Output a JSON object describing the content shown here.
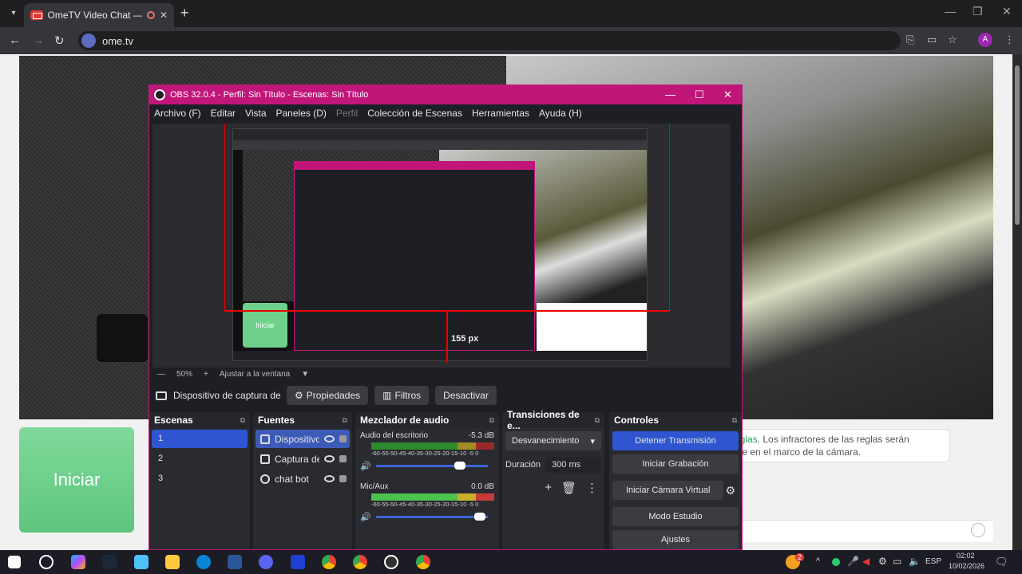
{
  "browser": {
    "tab_title": "OmeTV Video Chat — Ome",
    "url": "ome.tv",
    "profile_initial": "A"
  },
  "page": {
    "start_label": "Iniciar",
    "rules_link": "eglas",
    "rules_text_1": ". Los infractores de las reglas serán",
    "rules_text_2": "ple en el marco de la cámara."
  },
  "obs": {
    "title": "OBS 32.0.4 - Perfil: Sin Título - Escenas: Sin Título",
    "menu": [
      "Archivo (F)",
      "Editar",
      "Vista",
      "Paneles (D)",
      "Perfil",
      "Colección de Escenas",
      "Herramientas",
      "Ayuda (H)"
    ],
    "preview": {
      "nested_start_label": "Iniciar",
      "pixel_label": "155 px",
      "zoom": "50%",
      "fit_label": "Ajustar a la ventana"
    },
    "source_bar": {
      "source_label": "Dispositivo de captura de v",
      "properties": "Propiedades",
      "filters": "Filtros",
      "deactivate": "Desactivar"
    },
    "scenes": {
      "title": "Escenas",
      "items": [
        "1",
        "2",
        "3"
      ]
    },
    "sources": {
      "title": "Fuentes",
      "items": [
        "Dispositivo",
        "Captura de",
        "chat bot"
      ]
    },
    "mixer": {
      "title": "Mezclador de audio",
      "ticks": "-60-55-50-45-40-35-30-25-20-15-10 -5 0",
      "channels": [
        {
          "name": "Audio del escritorio",
          "db": "-5.3 dB",
          "volume": 0.78
        },
        {
          "name": "Mic/Aux",
          "db": "0.0 dB",
          "volume": 0.98
        }
      ]
    },
    "transitions": {
      "title": "Transiciones de e...",
      "selected": "Desvanecimiento",
      "duration_label": "Duración",
      "duration_value": "300 ms"
    },
    "controls": {
      "title": "Controles",
      "buttons": [
        "Detener Transmisión",
        "Iniciar Grabación",
        "Iniciar Cámara Virtual",
        "Modo Estudio",
        "Ajustes"
      ]
    }
  },
  "taskbar": {
    "language": "ESP",
    "time": "02:02",
    "date": "10/02/2026",
    "notification_count": "2"
  }
}
